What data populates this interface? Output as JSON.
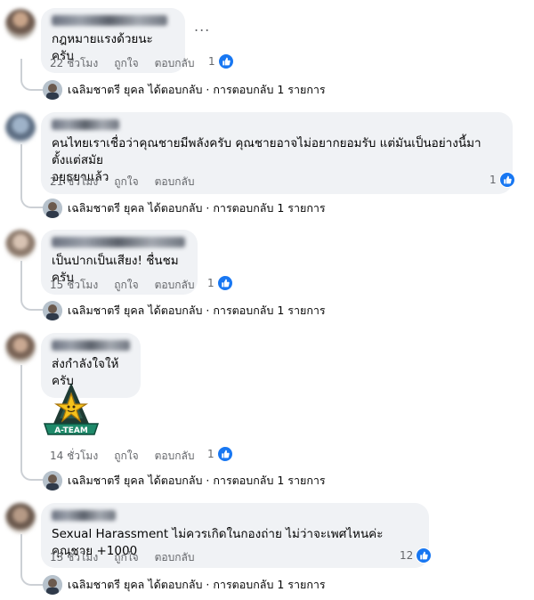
{
  "comments": [
    {
      "text": "กฎหมายแรงด้วยนะครับ",
      "time": "22 ชั่วโมง",
      "like": "ถูกใจ",
      "reply": "ตอบกลับ",
      "reactions": "1",
      "reply_summary": "เฉลิมชาตรี ยุคล ได้ตอบกลับ · การตอบกลับ 1 รายการ"
    },
    {
      "text": "คนไทยเราเชื่อว่าคุณชายมีพลังครับ คุณชายอาจไม่อยากยอมรับ แต่มันเป็นอย่างนี้มาตั้งแต่สมัย\nอยุธยาแล้ว",
      "time": "21 ชั่วโมง",
      "like": "ถูกใจ",
      "reply": "ตอบกลับ",
      "reactions": "1",
      "reply_summary": "เฉลิมชาตรี ยุคล ได้ตอบกลับ · การตอบกลับ 1 รายการ"
    },
    {
      "text": "เป็นปากเป็นเสียง! ชื่นชมครับ",
      "time": "15 ชั่วโมง",
      "like": "ถูกใจ",
      "reply": "ตอบกลับ",
      "reactions": "1",
      "reply_summary": "เฉลิมชาตรี ยุคล ได้ตอบกลับ · การตอบกลับ 1 รายการ"
    },
    {
      "text": "ส่งกำลังใจให้ครับ",
      "sticker_text": "A-TEAM",
      "time": "14 ชั่วโมง",
      "like": "ถูกใจ",
      "reply": "ตอบกลับ",
      "reactions": "1",
      "reply_summary": "เฉลิมชาตรี ยุคล ได้ตอบกลับ · การตอบกลับ 1 รายการ"
    },
    {
      "text": "Sexual Harassment ไม่ควรเกิดในกองถ่าย ไม่ว่าจะเพศไหนค่ะคุณชาย +1000",
      "time": "13 ชั่วโมง",
      "like": "ถูกใจ",
      "reply": "ตอบกลับ",
      "reactions": "12",
      "reply_summary": "เฉลิมชาตรี ยุคล ได้ตอบกลับ · การตอบกลับ 1 รายการ"
    }
  ],
  "more_options": "...",
  "colors": {
    "bubble": "#f0f2f5",
    "meta_text": "#65676b",
    "like_blue": "#1877f2",
    "thread_line": "#ccd0d5"
  },
  "icons": [
    "thumbs-up-icon",
    "more-options-icon",
    "reply-arrow-icon"
  ]
}
